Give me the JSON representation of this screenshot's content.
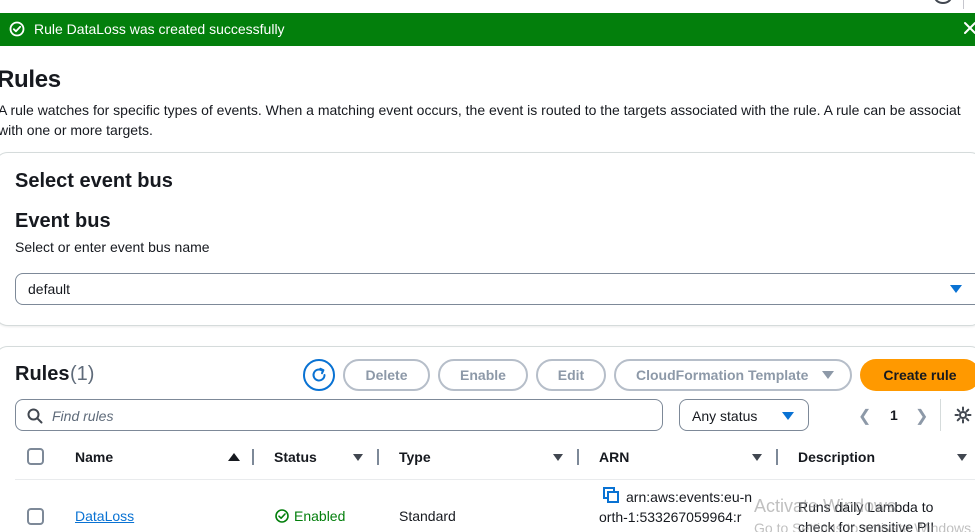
{
  "flash": {
    "message": "Rule DataLoss was created successfully"
  },
  "header": {
    "title": "Rules",
    "description": "A rule watches for specific types of events. When a matching event occurs, the event is routed to the targets associated with the rule. A rule can be associat with one or more targets."
  },
  "event_bus": {
    "heading": "Select event bus",
    "label": "Event bus",
    "hint": "Select or enter event bus name",
    "selected": "default"
  },
  "rules": {
    "title": "Rules",
    "count": "(1)",
    "buttons": {
      "delete": "Delete",
      "enable": "Enable",
      "edit": "Edit",
      "cloudformation": "CloudFormation Template",
      "create": "Create rule"
    },
    "search_placeholder": "Find rules",
    "status_filter": "Any status",
    "page": "1",
    "columns": [
      "Name",
      "Status",
      "Type",
      "ARN",
      "Description"
    ],
    "rows": [
      {
        "name": "DataLoss",
        "status": "Enabled",
        "type": "Standard",
        "arn_line1": "arn:aws:events:eu-n",
        "arn_line2": "orth-1:533267059964:r",
        "description_line1": "Runs daily Lambda to",
        "description_line2": "check for sensitive PII"
      }
    ]
  },
  "watermark": {
    "line1": "Activate Windows",
    "line2": "Go to Settings to activate Windows."
  },
  "colors": {
    "success_green": "#037f0c",
    "link_blue": "#0972d3",
    "primary_orange": "#ff9900",
    "disabled_grey": "#8d99a8"
  },
  "icons": [
    "check-circle-icon",
    "close-icon",
    "refresh-icon",
    "search-icon",
    "settings-gear-icon",
    "copy-icon",
    "caret-down-icon",
    "sort-ascending-icon",
    "sort-descending-icon"
  ]
}
